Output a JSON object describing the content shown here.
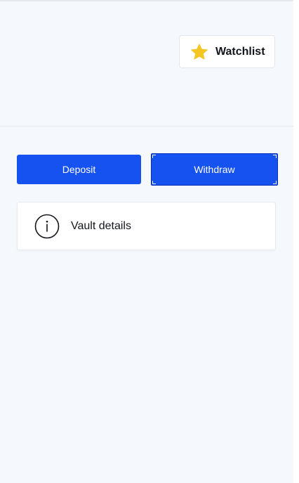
{
  "header": {
    "watchlist_label": "Watchlist",
    "watchlist_icon": "star-icon",
    "star_color": "#f4c622"
  },
  "actions": {
    "deposit_label": "Deposit",
    "withdraw_label": "Withdraw",
    "button_color": "#1652f0"
  },
  "vault": {
    "label": "Vault details",
    "icon": "info-icon"
  }
}
